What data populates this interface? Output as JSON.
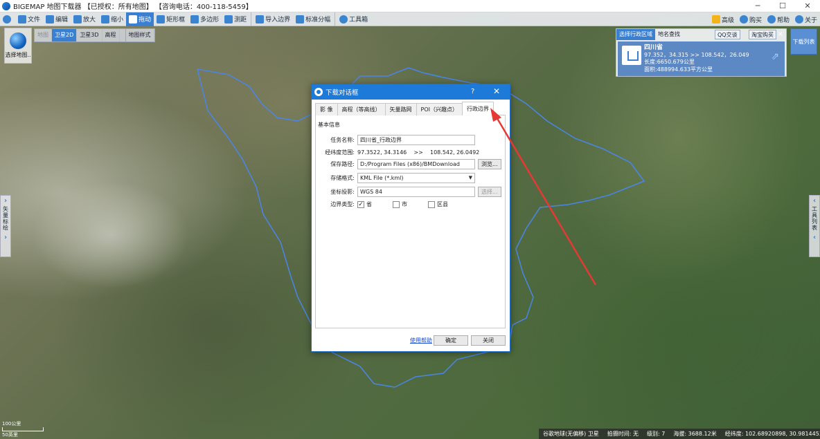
{
  "window": {
    "title": "BIGEMAP 地图下载器 【已授权：所有地图】 【咨询电话：400-118-5459】",
    "controls": {
      "minimize": "─",
      "maximize": "☐",
      "close": "✕"
    }
  },
  "toolbar": {
    "items": [
      {
        "label": "文件",
        "icon": "folder-icon"
      },
      {
        "label": "编辑",
        "icon": "edit-icon"
      },
      {
        "label": "放大",
        "icon": "zoom-in-icon"
      },
      {
        "label": "缩小",
        "icon": "zoom-out-icon"
      },
      {
        "label": "拖动",
        "icon": "hand-icon"
      },
      {
        "label": "矩形框",
        "icon": "rectangle-icon"
      },
      {
        "label": "多边形",
        "icon": "polygon-icon"
      },
      {
        "label": "测距",
        "icon": "ruler-icon"
      },
      {
        "label": "导入边界",
        "icon": "import-icon"
      },
      {
        "label": "标准分幅",
        "icon": "grid-icon"
      },
      {
        "label": "工具箱",
        "icon": "gear-icon"
      }
    ],
    "right": [
      {
        "label": "高级",
        "icon": "diamond-icon"
      },
      {
        "label": "购买",
        "icon": "cart-icon"
      },
      {
        "label": "帮助",
        "icon": "help-icon"
      },
      {
        "label": "关于",
        "icon": "info-icon"
      }
    ]
  },
  "map_type": {
    "label": "选择地图.."
  },
  "view_tabs": [
    "地图",
    "卫星2D",
    "卫星3D",
    "高程",
    "地图样式"
  ],
  "region_panel": {
    "tabs": [
      "选择行政区域",
      "地名查找"
    ],
    "qq": "QQ交谈",
    "taobao": "淘宝购买",
    "name": "四川省",
    "coords": "97.352，34.315 >> 108.542，26.049",
    "length": "长度:6650.679公里",
    "area": "面积:488994.633平方公里",
    "close": "×"
  },
  "download_list": "下载列表",
  "side_left": {
    "label": "矢量标绘"
  },
  "side_right": {
    "label": "工具列表"
  },
  "dialog": {
    "title": "下载对话框",
    "help": "?",
    "close": "✕",
    "tabs": [
      "影 像",
      "高程（等高线）",
      "矢量路网",
      "POI（兴趣点）",
      "行政边界"
    ],
    "section": "基本信息",
    "task_label": "任务名称:",
    "task_value": "四川省_行政边界",
    "range_label": "经纬度范围:",
    "range_value": "97.3522, 34.3146    >>    108.542, 26.0492",
    "path_label": "保存路径:",
    "path_value": "D:/Program Files (x86)/BMDownload",
    "browse": "浏览...",
    "format_label": "存储格式:",
    "format_value": "KML File (*.kml)",
    "proj_label": "坐标投影:",
    "proj_value": "WGS 84",
    "select": "选择...",
    "boundary_label": "边界类型:",
    "boundary_options": [
      {
        "label": "省",
        "checked": true
      },
      {
        "label": "市",
        "checked": false
      },
      {
        "label": "区县",
        "checked": false
      }
    ],
    "help_link": "使用帮助",
    "ok": "确定",
    "cancel": "关闭"
  },
  "status": {
    "source": "谷歌地球(无偏移) 卫星",
    "date": "拍摄时间: 无",
    "level": "级别:  7",
    "altitude": "海拔: 3688.12米",
    "lnglat": "经纬度:  102.68920898, 30.98144531"
  },
  "scale": {
    "km": "100公里",
    "mi": "50英里"
  },
  "colors": {
    "accent": "#1e7ad8",
    "boundary": "#4a86e8",
    "arrow": "#e53935"
  }
}
